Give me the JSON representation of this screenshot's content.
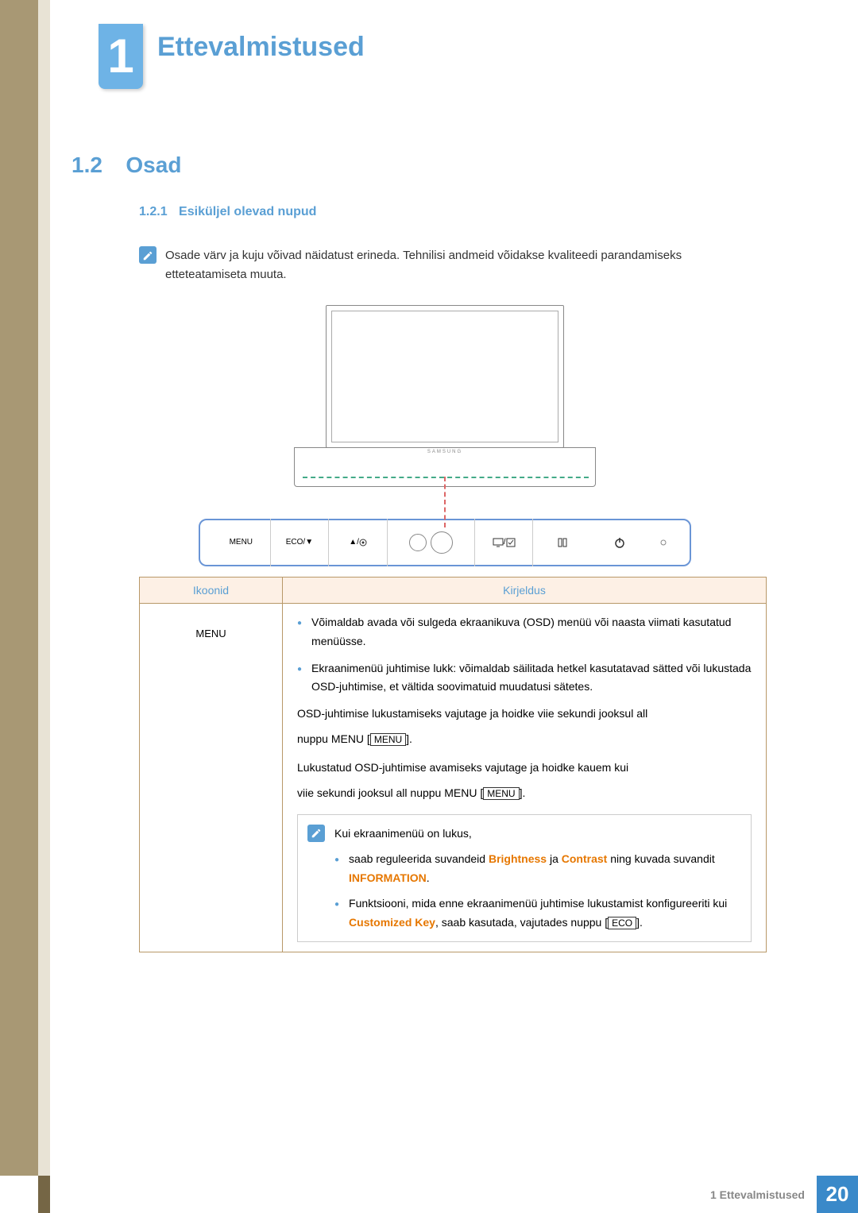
{
  "chapter": {
    "number": "1",
    "title": "Ettevalmistused"
  },
  "section": {
    "number": "1.2",
    "title": "Osad"
  },
  "subsection": {
    "number": "1.2.1",
    "title": "Esiküljel olevad nupud"
  },
  "intro_text": "Osade värv ja kuju võivad näidatust erineda. Tehnilisi andmeid võidakse kvaliteedi parandamiseks etteteatamiseta muuta.",
  "diagram": {
    "brand_mark": "SAMSUNG",
    "buttons": {
      "menu": "MENU",
      "eco": "ECO/▼",
      "up": "▲/",
      "source": "/",
      "auto": "",
      "power": ""
    }
  },
  "table": {
    "header": {
      "col1": "Ikoonid",
      "col2": "Kirjeldus"
    },
    "row1": {
      "icon": "MENU",
      "desc": {
        "b1": "Võimaldab avada või sulgeda ekraanikuva (OSD) menüü või naasta viimati kasutatud menüüsse.",
        "b2": "Ekraanimenüü juhtimise lukk: võimaldab säilitada hetkel kasutatavad sätted või lukustada OSD-juhtimise, et vältida soovimatuid muudatusi sätetes.",
        "line3a": "OSD-juhtimise lukustamiseks vajutage ja hoidke viie sekundi jooksul all",
        "line3b_pre": "nuppu MENU [",
        "line3b_box": "MENU",
        "line3b_post": "].",
        "line4": "Lukustatud OSD-juhtimise avamiseks vajutage ja hoidke kauem kui",
        "line5_pre": "viie sekundi jooksul all nuppu MENU [",
        "line5_box": "MENU",
        "line5_post": "].",
        "note_intro": "Kui ekraanimenüü on lukus,",
        "note_b1_pre": "saab reguleerida suvandeid ",
        "note_b1_h1": "Brightness",
        "note_b1_mid": " ja ",
        "note_b1_h2": "Contrast",
        "note_b1_mid2": " ning kuvada suvandit ",
        "note_b1_h3": "INFORMATION",
        "note_b1_post": ".",
        "note_b2_pre": "Funktsiooni, mida enne ekraanimenüü juhtimise lukustamist konfigureeriti kui ",
        "note_b2_h1": "Customized Key",
        "note_b2_post_pre": ", saab kasutada, vajutades nuppu [",
        "note_b2_box": "ECO",
        "note_b2_post": "]."
      }
    }
  },
  "footer": {
    "text": "1 Ettevalmistused",
    "page": "20"
  }
}
